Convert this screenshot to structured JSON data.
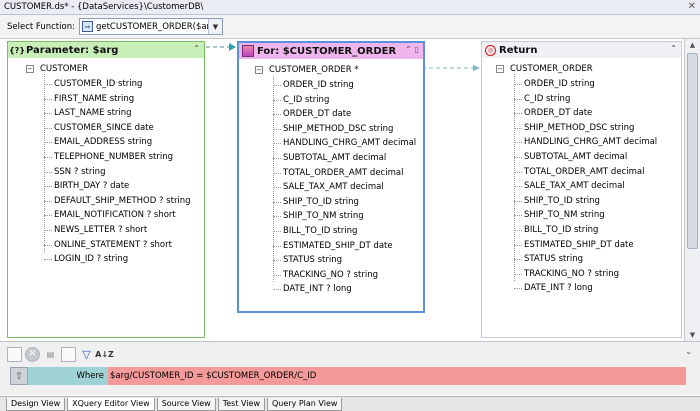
{
  "window": {
    "title": "CUSTOMER.ds* - {DataServices}\\CustomerDB\\"
  },
  "function_bar": {
    "label": "Select Function:",
    "selected": "getCUSTOMER_ORDER($arg)"
  },
  "param_panel": {
    "title": "Parameter: $arg",
    "root": "CUSTOMER",
    "fields": [
      "CUSTOMER_ID string",
      "FIRST_NAME string",
      "LAST_NAME string",
      "CUSTOMER_SINCE date",
      "EMAIL_ADDRESS string",
      "TELEPHONE_NUMBER string",
      "SSN ? string",
      "BIRTH_DAY ? date",
      "DEFAULT_SHIP_METHOD ? string",
      "EMAIL_NOTIFICATION ? short",
      "NEWS_LETTER ? short",
      "ONLINE_STATEMENT ? short",
      "LOGIN_ID ? string"
    ]
  },
  "for_panel": {
    "title": "For: $CUSTOMER_ORDER",
    "root": "CUSTOMER_ORDER *",
    "fields": [
      "ORDER_ID string",
      "C_ID string",
      "ORDER_DT date",
      "SHIP_METHOD_DSC string",
      "HANDLING_CHRG_AMT decimal",
      "SUBTOTAL_AMT decimal",
      "TOTAL_ORDER_AMT decimal",
      "SALE_TAX_AMT decimal",
      "SHIP_TO_ID string",
      "SHIP_TO_NM string",
      "BILL_TO_ID string",
      "ESTIMATED_SHIP_DT date",
      "STATUS string",
      "TRACKING_NO ? string",
      "DATE_INT ? long"
    ]
  },
  "return_panel": {
    "title": "Return",
    "root": "CUSTOMER_ORDER",
    "fields": [
      "ORDER_ID string",
      "C_ID string",
      "ORDER_DT date",
      "SHIP_METHOD_DSC string",
      "HANDLING_CHRG_AMT decimal",
      "SUBTOTAL_AMT decimal",
      "TOTAL_ORDER_AMT decimal",
      "SALE_TAX_AMT decimal",
      "SHIP_TO_ID string",
      "SHIP_TO_NM string",
      "BILL_TO_ID string",
      "ESTIMATED_SHIP_DT date",
      "STATUS string",
      "TRACKING_NO ? string",
      "DATE_INT ? long"
    ]
  },
  "where_clause": {
    "label": "Where",
    "expression": "$arg/CUSTOMER_ID = $CUSTOMER_ORDER/C_ID"
  },
  "bottom_tabs": [
    "Design View",
    "XQuery Editor View",
    "Source View",
    "Test View",
    "Query Plan View"
  ],
  "active_tab_index": 1,
  "colors": {
    "param_header": "#c9efb9",
    "for_header": "#efb6ee",
    "for_border": "#5c8fdc",
    "where_label_bg": "#9fd2d4",
    "where_expr_bg": "#f49a9a"
  },
  "icons": {
    "param": "question-bracket-icon",
    "for": "for-clause-icon",
    "return": "return-target-icon",
    "filter": "filter-icon",
    "sort": "sort-az-icon"
  }
}
